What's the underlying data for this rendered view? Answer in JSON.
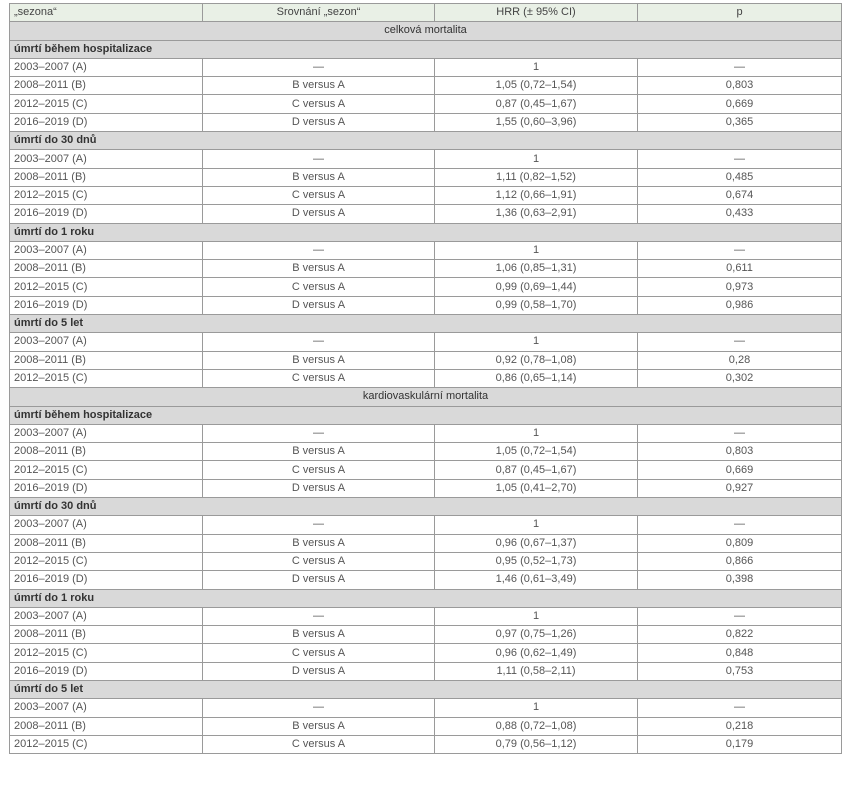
{
  "table": {
    "headers": [
      "„sezona“",
      "Srovnání „sezon“",
      "HRR (± 95% CI)",
      "p"
    ],
    "sections": [
      {
        "title": "celková mortalita",
        "groups": [
          {
            "title": "úmrtí během hospitalizace",
            "rows": [
              [
                "2003–2007 (A)",
                "—",
                "1",
                "—"
              ],
              [
                "2008–2011 (B)",
                "B versus A",
                "1,05 (0,72–1,54)",
                "0,803"
              ],
              [
                "2012–2015 (C)",
                "C versus A",
                "0,87 (0,45–1,67)",
                "0,669"
              ],
              [
                "2016–2019 (D)",
                "D versus A",
                "1,55 (0,60–3,96)",
                "0,365"
              ]
            ]
          },
          {
            "title": "úmrtí do 30 dnů",
            "rows": [
              [
                "2003–2007 (A)",
                "—",
                "1",
                "—"
              ],
              [
                "2008–2011 (B)",
                "B versus A",
                "1,11 (0,82–1,52)",
                "0,485"
              ],
              [
                "2012–2015 (C)",
                "C versus A",
                "1,12 (0,66–1,91)",
                "0,674"
              ],
              [
                "2016–2019 (D)",
                "D versus A",
                "1,36 (0,63–2,91)",
                "0,433"
              ]
            ]
          },
          {
            "title": "úmrtí do 1 roku",
            "rows": [
              [
                "2003–2007 (A)",
                "—",
                "1",
                "—"
              ],
              [
                "2008–2011 (B)",
                "B versus A",
                "1,06 (0,85–1,31)",
                "0,611"
              ],
              [
                "2012–2015 (C)",
                "C versus A",
                "0,99 (0,69–1,44)",
                "0,973"
              ],
              [
                "2016–2019 (D)",
                "D versus A",
                "0,99 (0,58–1,70)",
                "0,986"
              ]
            ]
          },
          {
            "title": "úmrtí do 5 let",
            "rows": [
              [
                "2003–2007 (A)",
                "—",
                "1",
                "—"
              ],
              [
                "2008–2011 (B)",
                "B versus A",
                "0,92 (0,78–1,08)",
                "0,28"
              ],
              [
                "2012–2015 (C)",
                "C versus A",
                "0,86 (0,65–1,14)",
                "0,302"
              ]
            ]
          }
        ]
      },
      {
        "title": "kardiovaskulární mortalita",
        "groups": [
          {
            "title": "úmrtí během hospitalizace",
            "rows": [
              [
                "2003–2007 (A)",
                "—",
                "1",
                "—"
              ],
              [
                "2008–2011 (B)",
                "B versus A",
                "1,05 (0,72–1,54)",
                "0,803"
              ],
              [
                "2012–2015 (C)",
                "C versus A",
                "0,87 (0,45–1,67)",
                "0,669"
              ],
              [
                "2016–2019 (D)",
                "D versus A",
                "1,05 (0,41–2,70)",
                "0,927"
              ]
            ]
          },
          {
            "title": "úmrtí do 30 dnů",
            "rows": [
              [
                "2003–2007 (A)",
                "—",
                "1",
                "—"
              ],
              [
                "2008–2011 (B)",
                "B versus A",
                "0,96 (0,67–1,37)",
                "0,809"
              ],
              [
                "2012–2015 (C)",
                "C versus A",
                "0,95 (0,52–1,73)",
                "0,866"
              ],
              [
                "2016–2019 (D)",
                "D versus A",
                "1,46 (0,61–3,49)",
                "0,398"
              ]
            ]
          },
          {
            "title": "úmrtí do 1 roku",
            "rows": [
              [
                "2003–2007 (A)",
                "—",
                "1",
                "—"
              ],
              [
                "2008–2011 (B)",
                "B versus A",
                "0,97 (0,75–1,26)",
                "0,822"
              ],
              [
                "2012–2015 (C)",
                "C versus A",
                "0,96 (0,62–1,49)",
                "0,848"
              ],
              [
                "2016–2019 (D)",
                "D versus A",
                "1,11 (0,58–2,11)",
                "0,753"
              ]
            ]
          },
          {
            "title": "úmrtí do 5 let",
            "rows": [
              [
                "2003–2007 (A)",
                "—",
                "1",
                "—"
              ],
              [
                "2008–2011 (B)",
                "B versus A",
                "0,88 (0,72–1,08)",
                "0,218"
              ],
              [
                "2012–2015 (C)",
                "C versus A",
                "0,79 (0,56–1,12)",
                "0,179"
              ]
            ]
          }
        ]
      }
    ]
  }
}
